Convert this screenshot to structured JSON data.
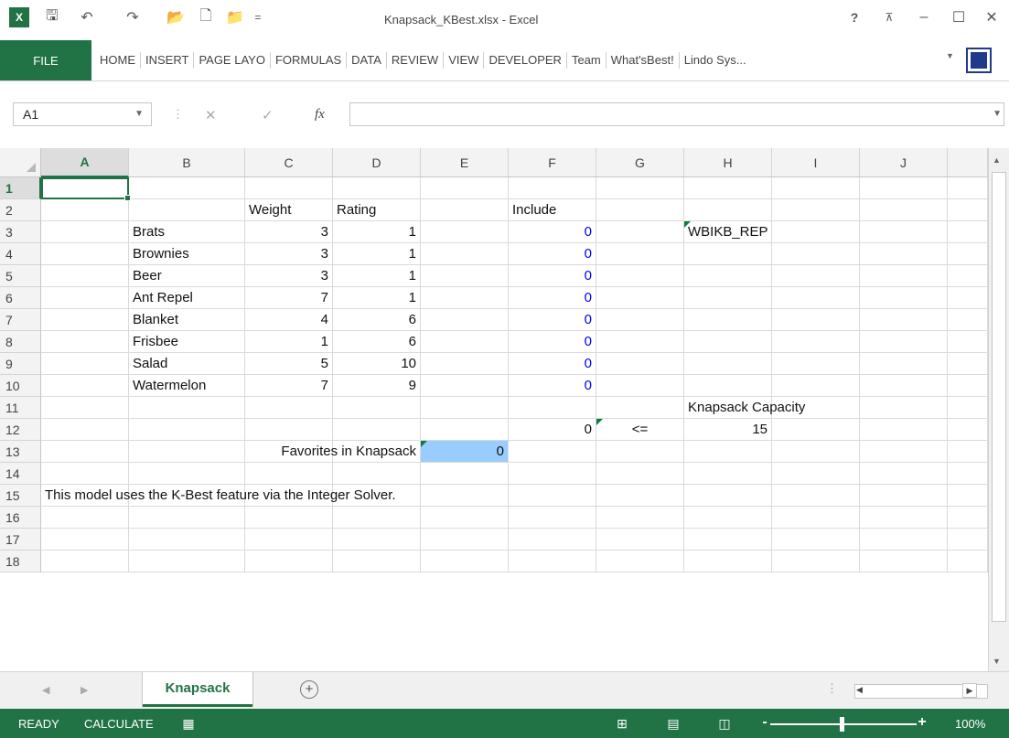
{
  "window": {
    "title": "Knapsack_KBest.xlsx - Excel",
    "help": "?",
    "minimize": "–",
    "maximize": "☐",
    "close": "✕"
  },
  "qat": {
    "app_icon": "X",
    "save": "🖫",
    "undo": "↶",
    "redo": "↷",
    "open": "📂",
    "new": "🗋",
    "more": "="
  },
  "ribbon": {
    "file_label": "FILE",
    "tabs": [
      "HOME",
      "INSERT",
      "PAGE LAYO",
      "FORMULAS",
      "DATA",
      "REVIEW",
      "VIEW",
      "DEVELOPER",
      "Team",
      "What'sBest!",
      "Lindo Sys..."
    ]
  },
  "formula_bar": {
    "name_box": "A1",
    "cancel": "✕",
    "enter": "✓",
    "fx": "fx",
    "value": ""
  },
  "columns": [
    "A",
    "B",
    "C",
    "D",
    "E",
    "F",
    "G",
    "H",
    "I",
    "J"
  ],
  "rows": [
    "1",
    "2",
    "3",
    "4",
    "5",
    "6",
    "7",
    "8",
    "9",
    "10",
    "11",
    "12",
    "13",
    "14",
    "15",
    "16",
    "17",
    "18"
  ],
  "cells": {
    "C2": "Weight",
    "D2": "Rating",
    "F2": "Include",
    "B3": "Brats",
    "C3": "3",
    "D3": "1",
    "F3": "0",
    "H3": "WBIKB_REP",
    "B4": "Brownies",
    "C4": "3",
    "D4": "1",
    "F4": "0",
    "B5": "Beer",
    "C5": "3",
    "D5": "1",
    "F5": "0",
    "B6": "Ant Repel",
    "C6": "7",
    "D6": "1",
    "F6": "0",
    "B7": "Blanket",
    "C7": "4",
    "D7": "6",
    "F7": "0",
    "B8": "Frisbee",
    "C8": "1",
    "D8": "6",
    "F8": "0",
    "B9": "Salad",
    "C9": "5",
    "D9": "10",
    "F9": "0",
    "B10": "Watermelon",
    "C10": "7",
    "D10": "9",
    "F10": "0",
    "H11": "Knapsack Capacity",
    "F12": "0",
    "G12": "<=",
    "H12": "15",
    "D13": "Favorites in Knapsack",
    "E13": "0",
    "A15": "This model uses the K-Best feature via the Integer Solver."
  },
  "colors": {
    "excel_green": "#217346",
    "include_blue": "#0000ff",
    "highlight_fill": "#99ccff"
  },
  "sheet_tabs": {
    "active": "Knapsack",
    "add": "+"
  },
  "status": {
    "ready": "READY",
    "calculate": "CALCULATE",
    "zoom": "100%",
    "zoom_minus": "-",
    "zoom_plus": "+"
  }
}
